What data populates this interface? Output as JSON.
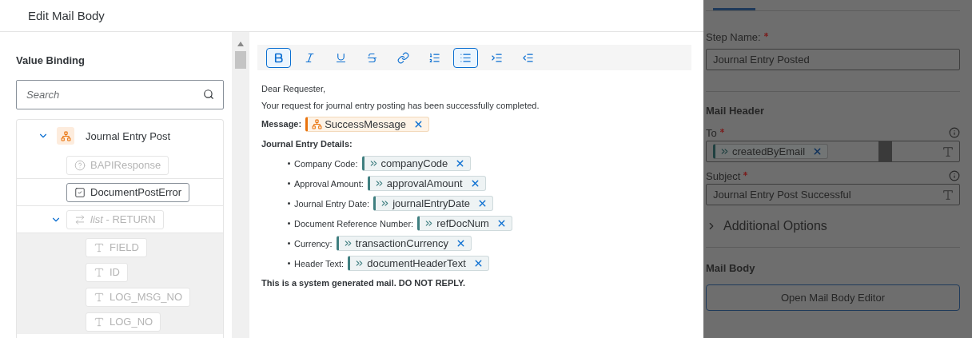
{
  "dialog": {
    "title": "Edit Mail Body"
  },
  "value_binding": {
    "title": "Value Binding",
    "search": {
      "placeholder": "Search"
    },
    "tree": [
      {
        "kind": "structure",
        "label": "Journal Entry Post",
        "expanded": true,
        "children": [
          {
            "kind": "unknown",
            "label": "BAPIResponse",
            "disabled": true
          },
          {
            "kind": "boolean",
            "label": "DocumentPostError",
            "disabled": false
          },
          {
            "kind": "list",
            "label": "*list* - RETURN",
            "disabled": true,
            "expanded": true,
            "children": [
              {
                "kind": "text",
                "label": "FIELD",
                "disabled": true
              },
              {
                "kind": "text",
                "label": "ID",
                "disabled": true
              },
              {
                "kind": "text",
                "label": "LOG_MSG_NO",
                "disabled": true
              },
              {
                "kind": "text",
                "label": "LOG_NO",
                "disabled": true
              }
            ]
          }
        ]
      }
    ]
  },
  "toolbar": [
    {
      "kind": "bold",
      "selected": true
    },
    {
      "kind": "italic",
      "selected": false
    },
    {
      "kind": "underline",
      "selected": false
    },
    {
      "kind": "strikethrough",
      "selected": false
    },
    {
      "kind": "link",
      "selected": false
    },
    {
      "kind": "numbered-list",
      "selected": false
    },
    {
      "kind": "bullet-list",
      "selected": true
    },
    {
      "kind": "indent",
      "selected": false
    },
    {
      "kind": "outdent",
      "selected": false
    }
  ],
  "body": [
    {
      "kind": "plain",
      "text": "Dear Requester,"
    },
    {
      "kind": "plain",
      "text": "Your request for journal entry posting has been successfully completed."
    },
    {
      "kind": "binding",
      "label": "Message:",
      "token": {
        "kind": "structure",
        "label": "SuccessMessage"
      }
    },
    {
      "kind": "heading",
      "text": "Journal Entry Details:"
    },
    {
      "kind": "list",
      "items": [
        {
          "label": "Company Code:",
          "token": {
            "kind": "field",
            "label": "companyCode"
          }
        },
        {
          "label": "Approval Amount:",
          "token": {
            "kind": "field",
            "label": "approvalAmount"
          }
        },
        {
          "label": "Journal Entry Date:",
          "token": {
            "kind": "field",
            "label": "journalEntryDate"
          }
        },
        {
          "label": "Document Reference Number:",
          "token": {
            "kind": "field",
            "label": "refDocNum"
          }
        },
        {
          "label": "Currency:",
          "token": {
            "kind": "field",
            "label": "transactionCurrency"
          }
        },
        {
          "label": "Header Text:",
          "token": {
            "kind": "field",
            "label": "documentHeaderText"
          }
        }
      ]
    },
    {
      "kind": "heading",
      "text": "This is a system generated mail. DO NOT REPLY."
    }
  ],
  "properties": {
    "step_name": {
      "label": "Step Name:",
      "required": true,
      "value": "Journal Entry Posted"
    },
    "mail_header": {
      "title": "Mail Header",
      "fields": [
        {
          "kind": "tokens",
          "label": "To",
          "required": true,
          "info": true,
          "tokens": [
            {
              "kind": "field",
              "label": "createdByEmail"
            }
          ]
        },
        {
          "kind": "text",
          "label": "Subject",
          "required": true,
          "info": true,
          "value": "Journal Entry Post Successful"
        }
      ]
    },
    "additional_options": {
      "label": "Additional Options",
      "expanded": false
    },
    "mail_body": {
      "title": "Mail Body",
      "button": "Open Mail Body Editor"
    }
  }
}
